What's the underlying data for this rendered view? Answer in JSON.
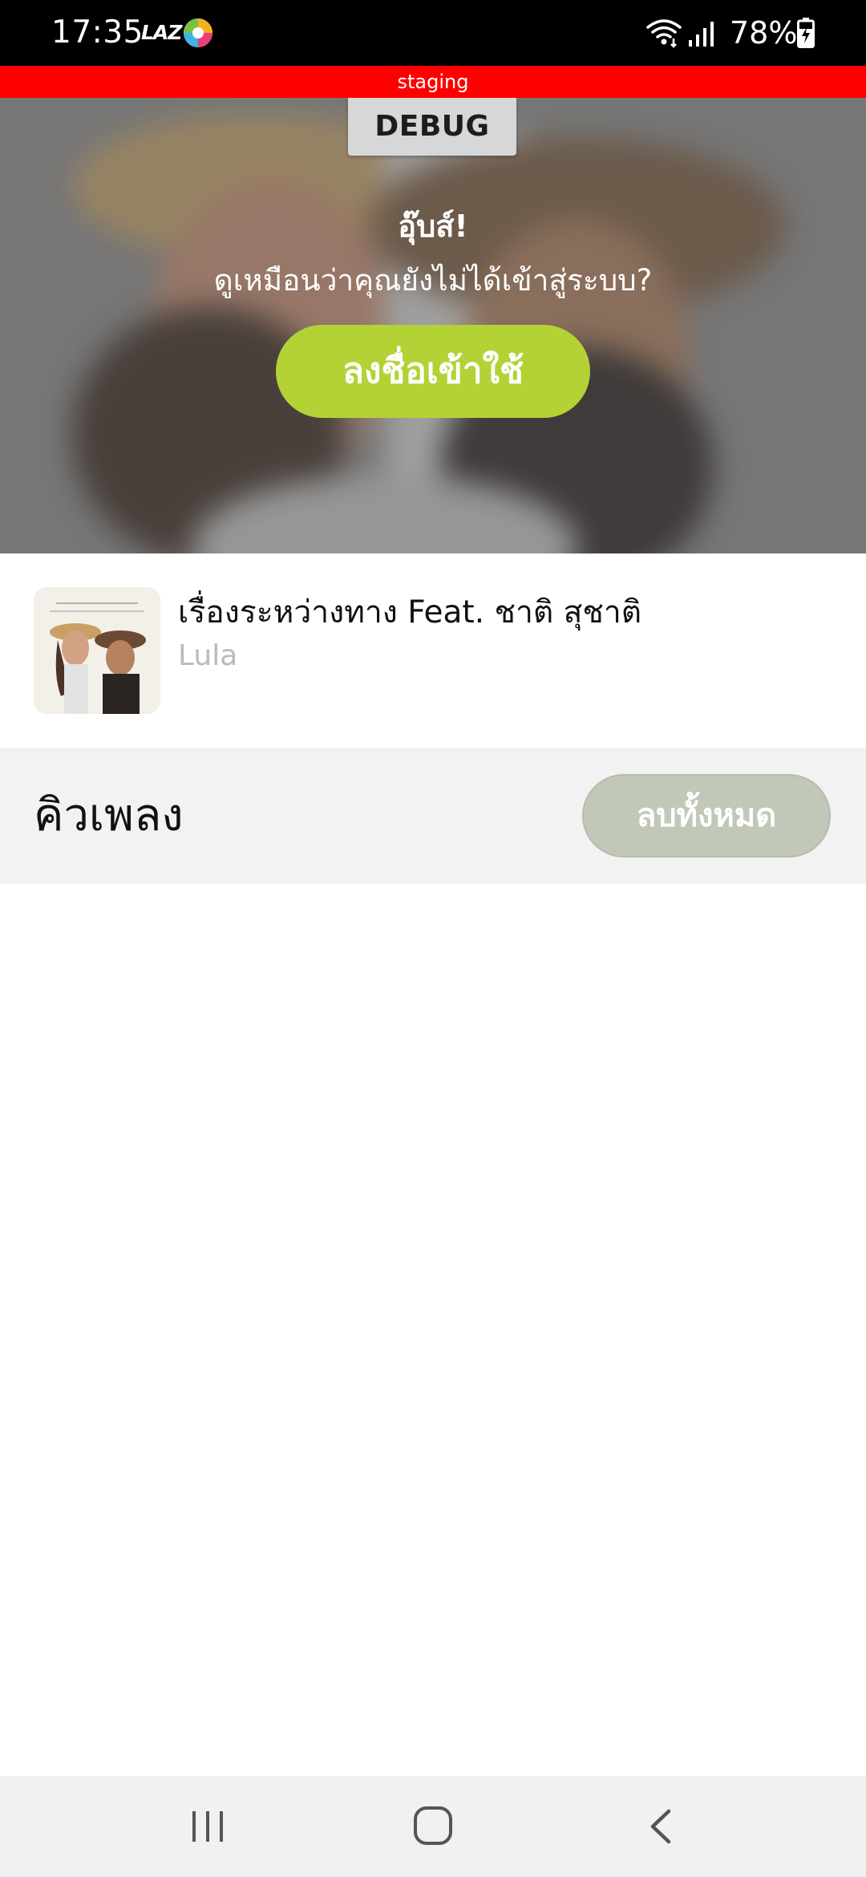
{
  "status_bar": {
    "time": "17:35",
    "notification_label": "LAZ",
    "battery_percent": "78%",
    "icons": [
      "laz-icon",
      "app-notification-icon",
      "wifi-icon",
      "signal-icon",
      "battery-charging-icon"
    ]
  },
  "staging_banner": {
    "label": "staging",
    "color": "#ff0000"
  },
  "hero": {
    "debug_label": "DEBUG",
    "title": "อุ๊บส์!",
    "subtitle": "ดูเหมือนว่าคุณยังไม่ได้เข้าสู่ระบบ?",
    "login_label": "ลงชื่อเข้าใช้",
    "login_color": "#b3d235"
  },
  "now_playing": {
    "title": "เรื่องระหว่างทาง Feat. ชาติ สุชาติ",
    "artist": "Lula",
    "artist_color": "#b9bdb4"
  },
  "queue": {
    "title": "คิวเพลง",
    "clear_all_label": "ลบทั้งหมด",
    "clear_all_color": "#c2c8b8",
    "items": []
  },
  "nav_bar": {
    "icons": [
      "recents-icon",
      "home-icon",
      "back-icon"
    ]
  }
}
